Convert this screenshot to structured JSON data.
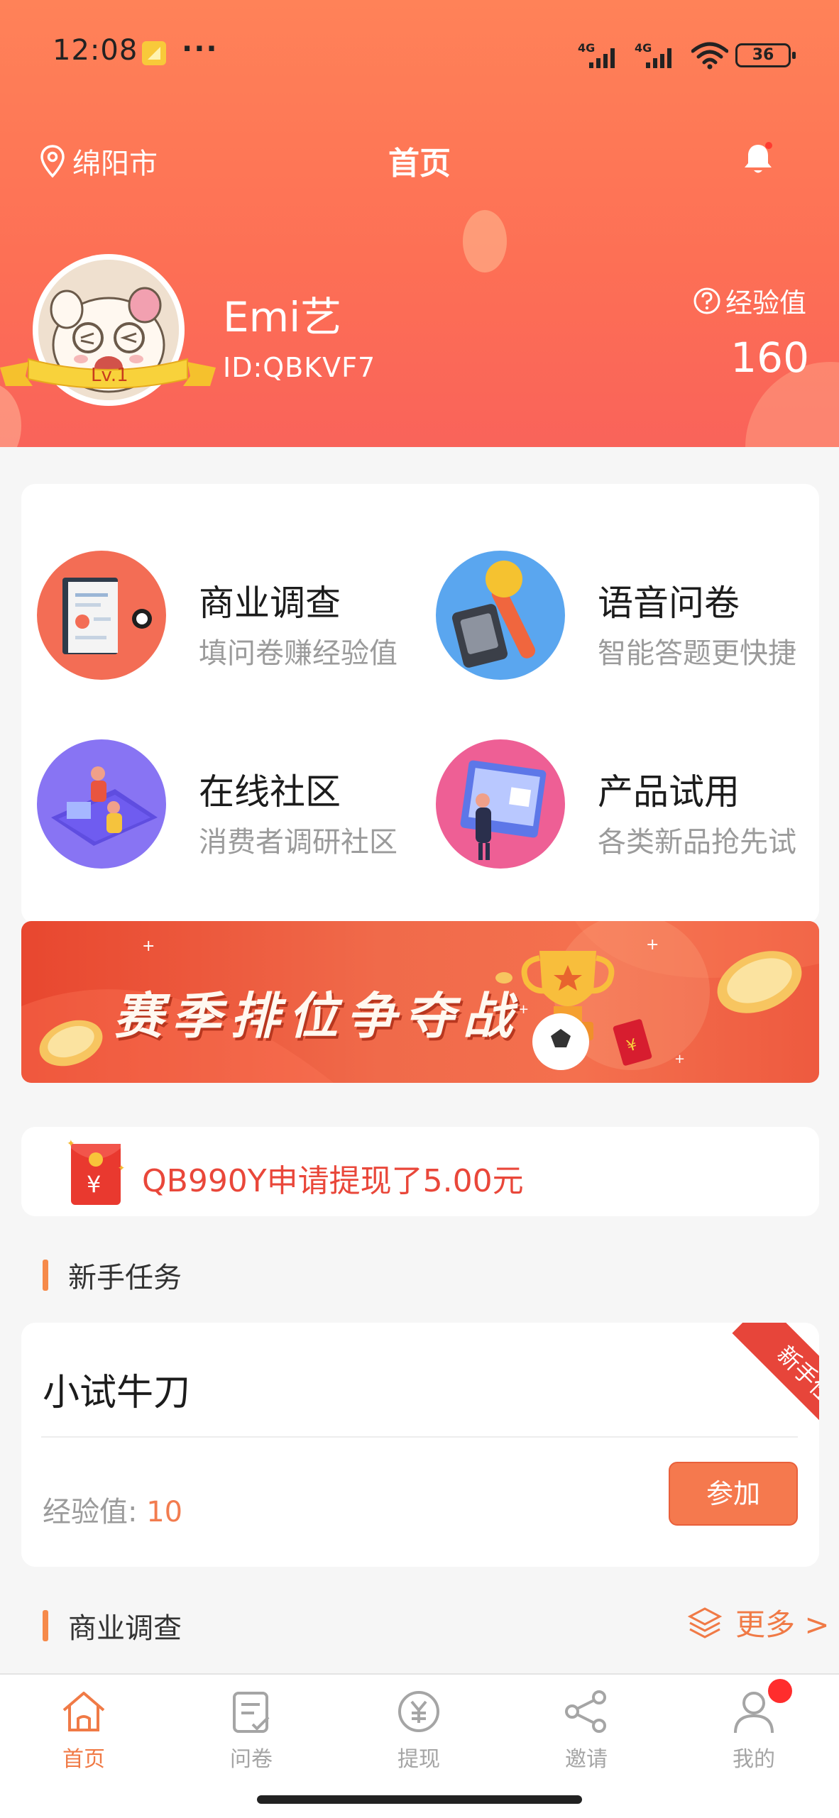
{
  "status_bar": {
    "time": "12:08",
    "network1": "4G",
    "network2": "4G",
    "battery": "36"
  },
  "header": {
    "location": "绵阳市",
    "title": "首页"
  },
  "user": {
    "name": "Emi艺",
    "id": "ID:QBKVF7",
    "level": "Lv.1",
    "exp_label": "经验值",
    "exp_value": "160"
  },
  "categories": [
    {
      "title": "商业调查",
      "subtitle": "填问卷赚经验值",
      "icon": "report-illustration"
    },
    {
      "title": "语音问卷",
      "subtitle": "智能答题更快捷",
      "icon": "microphone-illustration"
    },
    {
      "title": "在线社区",
      "subtitle": "消费者调研社区",
      "icon": "community-illustration"
    },
    {
      "title": "产品试用",
      "subtitle": "各类新品抢先试",
      "icon": "product-trial-illustration"
    }
  ],
  "banner": {
    "text": "赛季排位争夺战"
  },
  "notice": {
    "text": "QB990Y申请提现了5.00元"
  },
  "newbie_section": {
    "title": "新手任务"
  },
  "task": {
    "name": "小试牛刀",
    "exp_label": "经验值:",
    "exp_value": "10",
    "join_label": "参加",
    "ribbon": "新手任务"
  },
  "survey_section": {
    "title": "商业调查",
    "more_label": "更多 >"
  },
  "bottom_nav": [
    {
      "label": "首页",
      "icon": "home-icon",
      "active": true
    },
    {
      "label": "问卷",
      "icon": "questionnaire-icon",
      "active": false
    },
    {
      "label": "提现",
      "icon": "withdraw-icon",
      "active": false
    },
    {
      "label": "邀请",
      "icon": "share-icon",
      "active": false
    },
    {
      "label": "我的",
      "icon": "user-icon",
      "active": false
    }
  ],
  "colors": {
    "brand": "#f5794e",
    "header_top": "#ff8258",
    "header_bottom": "#f9635a",
    "notice_text": "#e9473a"
  }
}
